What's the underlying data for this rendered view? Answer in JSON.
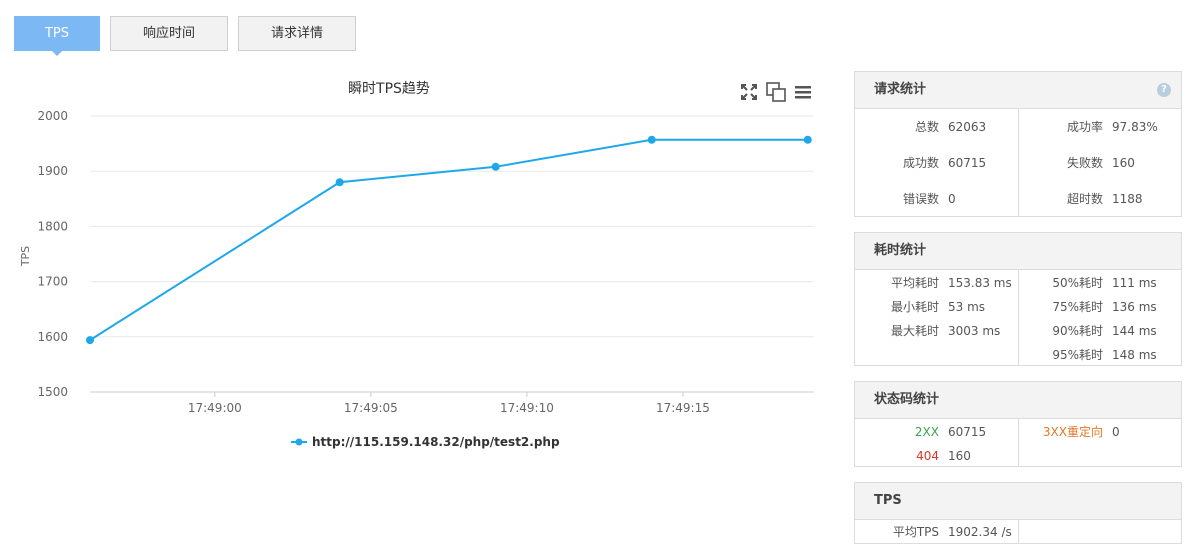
{
  "tabs": [
    {
      "label": "TPS",
      "active": true
    },
    {
      "label": "响应时间",
      "active": false
    },
    {
      "label": "请求详情",
      "active": false
    }
  ],
  "chart_data": {
    "type": "line",
    "title": "瞬时TPS趋势",
    "ylabel": "TPS",
    "xlabel": "",
    "ylim": [
      1500,
      2000
    ],
    "yticks": [
      1500,
      1600,
      1700,
      1800,
      1900,
      2000
    ],
    "xticks": [
      "17:49:00",
      "17:49:05",
      "17:49:10",
      "17:49:15"
    ],
    "xlim": [
      "17:48:56",
      "17:49:19.2"
    ],
    "series": [
      {
        "name": "http://115.159.148.32/php/test2.php",
        "color": "#1ea8ea",
        "points": [
          {
            "x": "17:48:56",
            "y": 1594
          },
          {
            "x": "17:49:04",
            "y": 1880
          },
          {
            "x": "17:49:09",
            "y": 1908
          },
          {
            "x": "17:49:14",
            "y": 1957
          },
          {
            "x": "17:49:19",
            "y": 1957
          }
        ]
      }
    ],
    "grid": true,
    "legend": "bottom"
  },
  "toolbar_icons": [
    "fullscreen-icon",
    "copy-icon",
    "menu-icon"
  ],
  "request_stats": {
    "title": "请求统计",
    "help": "?",
    "left": [
      {
        "label": "总数",
        "value": "62063"
      },
      {
        "label": "成功数",
        "value": "60715"
      },
      {
        "label": "错误数",
        "value": "0"
      }
    ],
    "right": [
      {
        "label": "成功率",
        "value": "97.83%"
      },
      {
        "label": "失败数",
        "value": "160"
      },
      {
        "label": "超时数",
        "value": "1188"
      }
    ]
  },
  "time_stats": {
    "title": "耗时统计",
    "left": [
      {
        "label": "平均耗时",
        "value": "153.83 ms"
      },
      {
        "label": "最小耗时",
        "value": "53 ms"
      },
      {
        "label": "最大耗时",
        "value": "3003 ms"
      }
    ],
    "right": [
      {
        "label": "50%耗时",
        "value": "111 ms"
      },
      {
        "label": "75%耗时",
        "value": "136 ms"
      },
      {
        "label": "90%耗时",
        "value": "144 ms"
      },
      {
        "label": "95%耗时",
        "value": "148 ms"
      }
    ]
  },
  "status_stats": {
    "title": "状态码统计",
    "left": [
      {
        "label": "2XX",
        "value": "60715"
      },
      {
        "label": "404",
        "value": "160"
      }
    ],
    "right": [
      {
        "label": "3XX重定向",
        "value": "0"
      }
    ]
  },
  "tps_stats": {
    "title": "TPS",
    "left": [
      {
        "label": "平均TPS",
        "value": "1902.34 /s"
      }
    ]
  },
  "colors": {
    "accent": "#7cb8f3",
    "line": "#1ea8ea",
    "ok": "#3aa24a",
    "error": "#d9362b",
    "redirect": "#e0782b"
  }
}
